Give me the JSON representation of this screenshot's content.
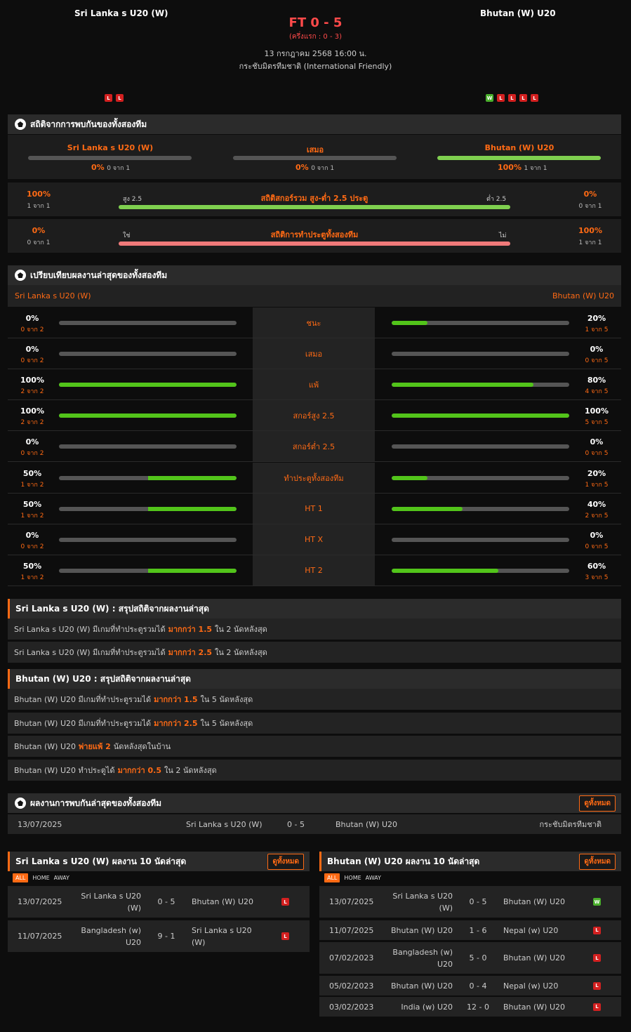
{
  "header": {
    "home": "Sri Lanka s U20 (W)",
    "away": "Bhutan (W) U20",
    "score": "FT 0 - 5",
    "halftime": "(ครึ่งแรก : 0 - 3)",
    "datetime": "13 กรกฎาคม 2568 16:00 น.",
    "competition": "กระชับมิตรทีมชาติ (International Friendly)",
    "home_form": [
      "L",
      "L"
    ],
    "away_form": [
      "W",
      "L",
      "L",
      "L",
      "L"
    ]
  },
  "h2h": {
    "title": "สถิติจากการพบกันของทั้งสองทีม",
    "cols": [
      {
        "label": "Sri Lanka s U20 (W)",
        "pct": "0%",
        "count": "0 จาก 1",
        "fill": 0
      },
      {
        "label": "เสมอ",
        "pct": "0%",
        "count": "0 จาก 1",
        "fill": 0
      },
      {
        "label": "Bhutan (W) U20",
        "pct": "100%",
        "count": "1 จาก 1",
        "fill": 1
      }
    ],
    "ou": {
      "left_pct": "100%",
      "left_count": "1 จาก 1",
      "left_label": "สูง 2.5",
      "title": "สถิติสกอร์รวม สูง-ต่ำ 2.5 ประตู",
      "right_label": "ต่ำ 2.5",
      "right_pct": "0%",
      "right_count": "0 จาก 1"
    },
    "btts": {
      "left_pct": "0%",
      "left_count": "0 จาก 1",
      "left_label": "ใช่",
      "title": "สถิติการทำประตูทั้งสองทีม",
      "right_label": "ไม่",
      "right_pct": "100%",
      "right_count": "1 จาก 1"
    }
  },
  "compare": {
    "title": "เปรียบเทียบผลงานล่าสุดของทั้งสองทีม",
    "home": "Sri Lanka s U20 (W)",
    "away": "Bhutan (W) U20",
    "rows": [
      {
        "label": "ชนะ",
        "lp": "0%",
        "lc": "0 จาก 2",
        "lf": 0,
        "rp": "20%",
        "rc": "1 จาก 5",
        "rf": 0.2
      },
      {
        "label": "เสมอ",
        "lp": "0%",
        "lc": "0 จาก 2",
        "lf": 0,
        "rp": "0%",
        "rc": "0 จาก 5",
        "rf": 0
      },
      {
        "label": "แพ้",
        "lp": "100%",
        "lc": "2 จาก 2",
        "lf": 1,
        "rp": "80%",
        "rc": "4 จาก 5",
        "rf": 0.8
      },
      {
        "label": "สกอร์สูง 2.5",
        "lp": "100%",
        "lc": "2 จาก 2",
        "lf": 1,
        "rp": "100%",
        "rc": "5 จาก 5",
        "rf": 1
      },
      {
        "label": "สกอร์ต่ำ 2.5",
        "lp": "0%",
        "lc": "0 จาก 2",
        "lf": 0,
        "rp": "0%",
        "rc": "0 จาก 5",
        "rf": 0
      },
      {
        "label": "ทำประตูทั้งสองทีม",
        "lp": "50%",
        "lc": "1 จาก 2",
        "lf": 0.5,
        "rp": "20%",
        "rc": "1 จาก 5",
        "rf": 0.2
      },
      {
        "label": "HT 1",
        "lp": "50%",
        "lc": "1 จาก 2",
        "lf": 0.5,
        "rp": "40%",
        "rc": "2 จาก 5",
        "rf": 0.4
      },
      {
        "label": "HT X",
        "lp": "0%",
        "lc": "0 จาก 2",
        "lf": 0,
        "rp": "0%",
        "rc": "0 จาก 5",
        "rf": 0
      },
      {
        "label": "HT 2",
        "lp": "50%",
        "lc": "1 จาก 2",
        "lf": 0.5,
        "rp": "60%",
        "rc": "3 จาก 5",
        "rf": 0.6
      }
    ]
  },
  "home_summary": {
    "title": "Sri Lanka s U20 (W) : สรุปสถิติจากผลงานล่าสุด",
    "rows": [
      {
        "a": "Sri Lanka s U20 (W)  มีเกมที่ทำประตูรวมได้",
        "b": "มากกว่า  1.5",
        "c": "ใน 2 นัดหลังสุด"
      },
      {
        "a": "Sri Lanka s U20 (W)  มีเกมที่ทำประตูรวมได้",
        "b": "มากกว่า  2.5",
        "c": "ใน 2 นัดหลังสุด"
      }
    ]
  },
  "away_summary": {
    "title": "Bhutan (W) U20 : สรุปสถิติจากผลงานล่าสุด",
    "rows": [
      {
        "a": "Bhutan (W) U20  มีเกมที่ทำประตูรวมได้",
        "b": "มากกว่า  1.5",
        "c": "ใน 5 นัดหลังสุด"
      },
      {
        "a": "Bhutan (W) U20  มีเกมที่ทำประตูรวมได้",
        "b": "มากกว่า  2.5",
        "c": "ใน 5 นัดหลังสุด"
      },
      {
        "a": "Bhutan (W) U20",
        "b": "พ่ายแพ้  2",
        "c": "นัดหลังสุดในบ้าน"
      },
      {
        "a": "Bhutan (W) U20  ทำประตูได้",
        "b": "มากกว่า  0.5",
        "c": "ใน 2 นัดหลังสุด"
      }
    ]
  },
  "recent_h2h": {
    "title": "ผลงานการพบกันล่าสุดของทั้งสองทีม",
    "button": "ดูทั้งหมด",
    "date": "13/07/2025",
    "home": "Sri Lanka s U20 (W)",
    "score": "0 - 5",
    "away": "Bhutan (W) U20",
    "comp": "กระชับมิตรทีมชาติ"
  },
  "home_last": {
    "title": "Sri Lanka s U20 (W) ผลงาน 10 นัดล่าสุด",
    "button": "ดูทั้งหมด",
    "filters": [
      "ALL",
      "HOME",
      "AWAY"
    ],
    "rows": [
      {
        "date": "13/07/2025",
        "home": "Sri Lanka s U20 (W)",
        "score": "0 - 5",
        "away": "Bhutan (W) U20",
        "res": "L"
      },
      {
        "date": "11/07/2025",
        "home": "Bangladesh (w) U20",
        "score": "9 - 1",
        "away": "Sri Lanka s U20 (W)",
        "res": "L"
      }
    ]
  },
  "away_last": {
    "title": "Bhutan (W) U20 ผลงาน 10 นัดล่าสุด",
    "button": "ดูทั้งหมด",
    "filters": [
      "ALL",
      "HOME",
      "AWAY"
    ],
    "rows": [
      {
        "date": "13/07/2025",
        "home": "Sri Lanka s U20 (W)",
        "score": "0 - 5",
        "away": "Bhutan (W) U20",
        "res": "W"
      },
      {
        "date": "11/07/2025",
        "home": "Bhutan (W) U20",
        "score": "1 - 6",
        "away": "Nepal (w) U20",
        "res": "L"
      },
      {
        "date": "07/02/2023",
        "home": "Bangladesh (w) U20",
        "score": "5 - 0",
        "away": "Bhutan (W) U20",
        "res": "L"
      },
      {
        "date": "05/02/2023",
        "home": "Bhutan (W) U20",
        "score": "0 - 4",
        "away": "Nepal (w) U20",
        "res": "L"
      },
      {
        "date": "03/02/2023",
        "home": "India (w) U20",
        "score": "12 - 0",
        "away": "Bhutan (W) U20",
        "res": "L"
      }
    ]
  },
  "colors": {
    "accent": "#ff6a14",
    "win": "#4ab02c",
    "loss": "#d32020",
    "green_bar": "#7fd04f",
    "red_bar": "#f07a7a"
  }
}
